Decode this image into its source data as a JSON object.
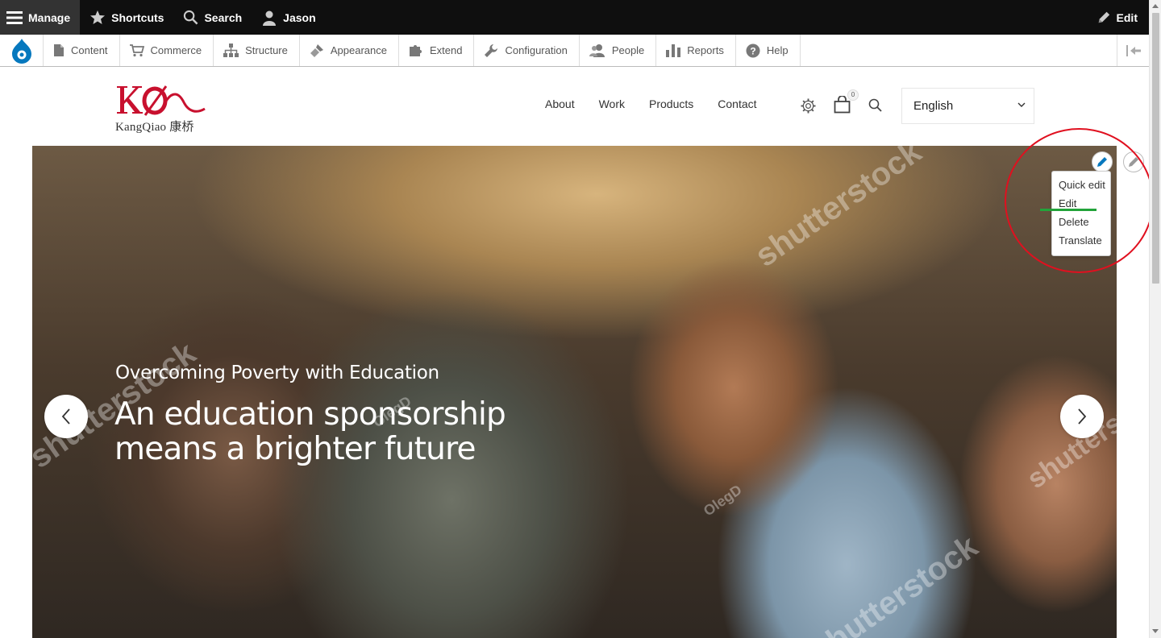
{
  "toolbar": {
    "manage": "Manage",
    "shortcuts": "Shortcuts",
    "search": "Search",
    "user": "Jason",
    "edit": "Edit"
  },
  "tray": {
    "items": [
      {
        "label": "Content",
        "icon": "file-icon"
      },
      {
        "label": "Commerce",
        "icon": "cart-icon"
      },
      {
        "label": "Structure",
        "icon": "sitemap-icon"
      },
      {
        "label": "Appearance",
        "icon": "brush-icon"
      },
      {
        "label": "Extend",
        "icon": "puzzle-icon"
      },
      {
        "label": "Configuration",
        "icon": "wrench-icon"
      },
      {
        "label": "People",
        "icon": "people-icon"
      },
      {
        "label": "Reports",
        "icon": "bar-chart-icon"
      },
      {
        "label": "Help",
        "icon": "help-icon"
      }
    ]
  },
  "header": {
    "logo_text": "KangQiao 康桥",
    "nav": [
      "About",
      "Work",
      "Products",
      "Contact"
    ],
    "cart_count": "0",
    "language": "English"
  },
  "hero": {
    "subtitle": "Overcoming Poverty with Education",
    "title": "An education sponsorship means a brighter future",
    "watermark_1": "shutterstock",
    "watermark_2": "OlegD"
  },
  "context_menu": {
    "items": [
      "Quick edit",
      "Edit",
      "Delete",
      "Translate"
    ]
  },
  "colors": {
    "toolbar_bg": "#0f0f0f",
    "brand_red": "#c8102e",
    "annotation_red": "#e0101f",
    "annotation_green": "#22a33a",
    "drupal_blue": "#0678be"
  }
}
